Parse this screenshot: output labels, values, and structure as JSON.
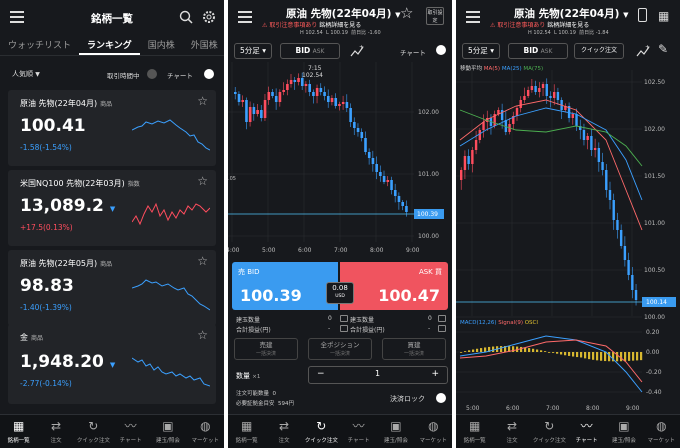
{
  "p1": {
    "title": "銘柄一覧",
    "tabs": [
      "ウォッチリスト",
      "ランキング",
      "国内株",
      "外国株"
    ],
    "filter": "人気順",
    "only_trading_label": "取引時間中",
    "chart_label": "チャート",
    "cards": [
      {
        "name": "原油 先物(22年04月)",
        "tag": "商品",
        "price": "100.41",
        "change": "-1.58(-1.54%)",
        "dir": "neg"
      },
      {
        "name": "米国NQ100 先物(22年03月)",
        "tag": "指数",
        "price": "13,089.2",
        "change": "+17.5(0.13%)",
        "dir": "pos"
      },
      {
        "name": "原油 先物(22年05月)",
        "tag": "商品",
        "price": "98.83",
        "change": "-1.40(-1.39%)",
        "dir": "neg"
      },
      {
        "name": "金",
        "tag": "商品",
        "price": "1,948.20",
        "change": "-2.77(-0.14%)",
        "dir": "neg"
      }
    ]
  },
  "p2": {
    "title": "原油 先物(22年04月)",
    "warn": "取引注意事項あり",
    "warn_link": "銘柄詳細を見る",
    "settings": "取引設定",
    "high": "H 102.54",
    "low": "L 100.19",
    "prev": "前日比 -1.60",
    "timeframe": "5分足",
    "bid": "BID",
    "ask": "ASK",
    "chart_label": "チャート",
    "chart": {
      "high_label": "7:15",
      "high_value": "102.54",
      "last": "100.39",
      "yticks": [
        "102.00",
        "101.00",
        "100.00"
      ],
      "xticks": [
        "4:00",
        "5:00",
        "6:00",
        "7:00",
        "8:00",
        "9:00"
      ],
      "left_tick": ".05"
    },
    "sell_label": "売 BID",
    "sell_price": "100.39",
    "buy_label": "ASK 買",
    "buy_price": "100.47",
    "spread": "0.08",
    "spread_unit": "USD",
    "rows": [
      {
        "l1": "建玉数量",
        "v1": "0",
        "l2": "建玉数量",
        "v2": "0"
      },
      {
        "l1": "合計損益(円)",
        "v1": "-",
        "l2": "合計損益(円)",
        "v2": "-"
      }
    ],
    "order_buttons": [
      {
        "label": "売建",
        "sub": "一括決済"
      },
      {
        "label": "全ポジション",
        "sub": "一括決済"
      },
      {
        "label": "買建",
        "sub": "一括決済"
      }
    ],
    "qty_label": "数量",
    "qty_mult": "×1",
    "qty_value": "1",
    "qty_minus": "−",
    "qty_plus": "+",
    "avail": "注文可能数量",
    "avail_val": "0",
    "margin": "必要証拠金目安",
    "margin_val": "594円",
    "close_lock": "決済ロック"
  },
  "p3": {
    "title": "原油 先物(22年04月)",
    "warn": "取引注意事項あり",
    "warn_link": "銘柄詳細を見る",
    "high": "H 102.54",
    "low": "L 100.19",
    "prev": "前日比 -1.84",
    "timeframe": "5分足",
    "bid": "BID",
    "ask": "ASK",
    "quick": "クイック注文",
    "ma_label": "移動平均",
    "ma_legend": [
      "MA(5)",
      "MA(25)",
      "MA(75)"
    ],
    "chart": {
      "yticks": [
        "102.50",
        "102.00",
        "101.50",
        "101.00",
        "100.50",
        "100.00"
      ],
      "last": "100.14",
      "xticks": [
        "5:00",
        "6:00",
        "7:00",
        "8:00",
        "9:00"
      ]
    },
    "macd_legend": [
      "MACD(12,26)",
      "Signal(9)",
      "OSCI"
    ],
    "macd_ticks": [
      "0.20",
      "0.00",
      "-0.20",
      "-0.40"
    ]
  },
  "nav1": [
    "銘柄一覧",
    "注文",
    "クイック注文",
    "チャート",
    "建玉/照会",
    "マーケット"
  ],
  "nav2": [
    "銘柄一覧",
    "注文",
    "クイック注文",
    "チャート",
    "建玉/照会",
    "マーケット"
  ],
  "nav3": [
    "銘柄一覧",
    "注文",
    "クイック注文",
    "チャート",
    "建玉/照会",
    "マーケット"
  ],
  "colors": {
    "bg": "#17191d",
    "card": "#222428",
    "down": "#3ba0ff",
    "up": "#ff4d5e",
    "sell": "#3a9bf0",
    "buy": "#f0545f"
  }
}
